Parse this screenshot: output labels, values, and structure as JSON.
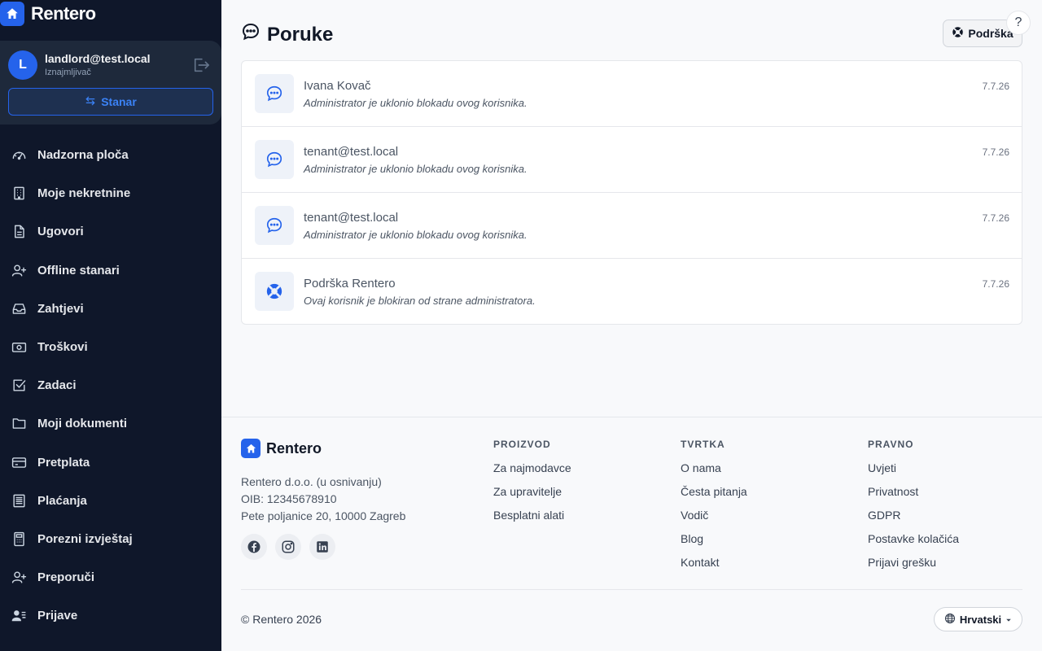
{
  "app": {
    "name": "Rentero"
  },
  "user": {
    "initial": "L",
    "email": "landlord@test.local",
    "role": "Iznajmljivač",
    "switch_label": "Stanar"
  },
  "nav": [
    {
      "label": "Nadzorna ploča",
      "icon": "dashboard-icon"
    },
    {
      "label": "Moje nekretnine",
      "icon": "building-icon"
    },
    {
      "label": "Ugovori",
      "icon": "document-icon"
    },
    {
      "label": "Offline stanari",
      "icon": "user-plus-icon"
    },
    {
      "label": "Zahtjevi",
      "icon": "inbox-icon"
    },
    {
      "label": "Troškovi",
      "icon": "cash-icon"
    },
    {
      "label": "Zadaci",
      "icon": "checkbox-icon"
    },
    {
      "label": "Moji dokumenti",
      "icon": "folder-icon"
    },
    {
      "label": "Pretplata",
      "icon": "card-icon"
    },
    {
      "label": "Plaćanja",
      "icon": "receipt-icon"
    },
    {
      "label": "Porezni izvještaj",
      "icon": "calculator-icon"
    },
    {
      "label": "Preporuči",
      "icon": "user-plus-icon"
    },
    {
      "label": "Prijave",
      "icon": "user-list-icon"
    }
  ],
  "page": {
    "title": "Poruke",
    "support_label": "Podrška",
    "help_label": "?"
  },
  "messages": [
    {
      "sender": "Ivana Kovač",
      "preview": "Administrator je uklonio blokadu ovog korisnika.",
      "date": "7.7.26",
      "icon": "chat-icon"
    },
    {
      "sender": "tenant@test.local",
      "preview": "Administrator je uklonio blokadu ovog korisnika.",
      "date": "7.7.26",
      "icon": "chat-icon"
    },
    {
      "sender": "tenant@test.local",
      "preview": "Administrator je uklonio blokadu ovog korisnika.",
      "date": "7.7.26",
      "icon": "chat-icon"
    },
    {
      "sender": "Podrška Rentero",
      "preview": "Ovaj korisnik je blokiran od strane administratora.",
      "date": "7.7.26",
      "icon": "lifebuoy-icon"
    }
  ],
  "footer": {
    "brand": "Rentero",
    "company_lines": [
      "Rentero d.o.o. (u osnivanju)",
      "OIB: 12345678910",
      "Pete poljanice 20, 10000 Zagreb"
    ],
    "social": [
      "facebook-icon",
      "instagram-icon",
      "linkedin-icon"
    ],
    "columns": [
      {
        "title": "PROIZVOD",
        "links": [
          "Za najmodavce",
          "Za upravitelje",
          "Besplatni alati"
        ]
      },
      {
        "title": "TVRTKA",
        "links": [
          "O nama",
          "Česta pitanja",
          "Vodič",
          "Blog",
          "Kontakt"
        ]
      },
      {
        "title": "PRAVNO",
        "links": [
          "Uvjeti",
          "Privatnost",
          "GDPR",
          "Postavke kolačića",
          "Prijavi grešku"
        ]
      }
    ],
    "copyright": "© Rentero 2026",
    "language": "Hrvatski"
  },
  "colors": {
    "accent": "#2563eb",
    "sidebar_bg": "#0f172a",
    "user_card_bg": "#1e293b"
  }
}
